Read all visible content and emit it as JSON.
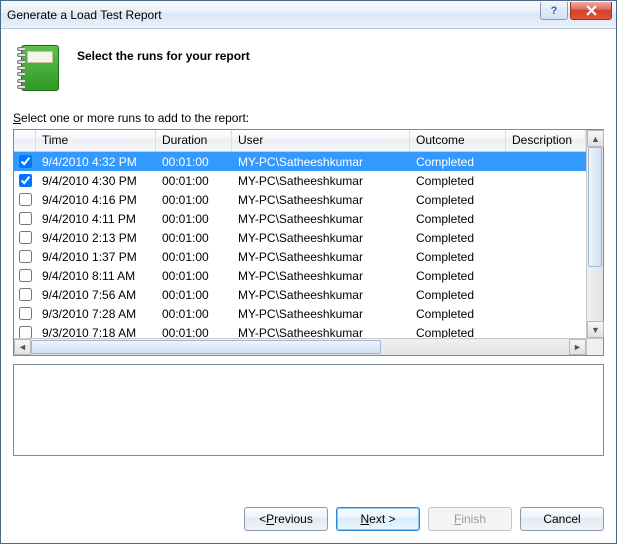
{
  "window": {
    "title": "Generate a Load Test Report"
  },
  "header": {
    "text": "Select the runs for your report"
  },
  "instruction": {
    "prefix_u": "S",
    "rest": "elect one or more runs to add to the report:"
  },
  "columns": {
    "time": "Time",
    "duration": "Duration",
    "user": "User",
    "outcome": "Outcome",
    "description": "Description"
  },
  "rows": [
    {
      "checked": true,
      "selected": true,
      "time": "9/4/2010 4:32 PM",
      "duration": "00:01:00",
      "user": "MY-PC\\Satheeshkumar",
      "outcome": "Completed",
      "description": ""
    },
    {
      "checked": true,
      "selected": false,
      "time": "9/4/2010 4:30 PM",
      "duration": "00:01:00",
      "user": "MY-PC\\Satheeshkumar",
      "outcome": "Completed",
      "description": ""
    },
    {
      "checked": false,
      "selected": false,
      "time": "9/4/2010 4:16 PM",
      "duration": "00:01:00",
      "user": "MY-PC\\Satheeshkumar",
      "outcome": "Completed",
      "description": ""
    },
    {
      "checked": false,
      "selected": false,
      "time": "9/4/2010 4:11 PM",
      "duration": "00:01:00",
      "user": "MY-PC\\Satheeshkumar",
      "outcome": "Completed",
      "description": ""
    },
    {
      "checked": false,
      "selected": false,
      "time": "9/4/2010 2:13 PM",
      "duration": "00:01:00",
      "user": "MY-PC\\Satheeshkumar",
      "outcome": "Completed",
      "description": ""
    },
    {
      "checked": false,
      "selected": false,
      "time": "9/4/2010 1:37 PM",
      "duration": "00:01:00",
      "user": "MY-PC\\Satheeshkumar",
      "outcome": "Completed",
      "description": ""
    },
    {
      "checked": false,
      "selected": false,
      "time": "9/4/2010 8:11 AM",
      "duration": "00:01:00",
      "user": "MY-PC\\Satheeshkumar",
      "outcome": "Completed",
      "description": ""
    },
    {
      "checked": false,
      "selected": false,
      "time": "9/4/2010 7:56 AM",
      "duration": "00:01:00",
      "user": "MY-PC\\Satheeshkumar",
      "outcome": "Completed",
      "description": ""
    },
    {
      "checked": false,
      "selected": false,
      "time": "9/3/2010 7:28 AM",
      "duration": "00:01:00",
      "user": "MY-PC\\Satheeshkumar",
      "outcome": "Completed",
      "description": ""
    },
    {
      "checked": false,
      "selected": false,
      "time": "9/3/2010 7:18 AM",
      "duration": "00:01:00",
      "user": "MY-PC\\Satheeshkumar",
      "outcome": "Completed",
      "description": ""
    }
  ],
  "buttons": {
    "previous_u": "P",
    "previous_pre": "< ",
    "previous_post": "revious",
    "next_u": "N",
    "next_post": "ext >",
    "finish_u": "F",
    "finish_post": "inish",
    "cancel": "Cancel"
  }
}
